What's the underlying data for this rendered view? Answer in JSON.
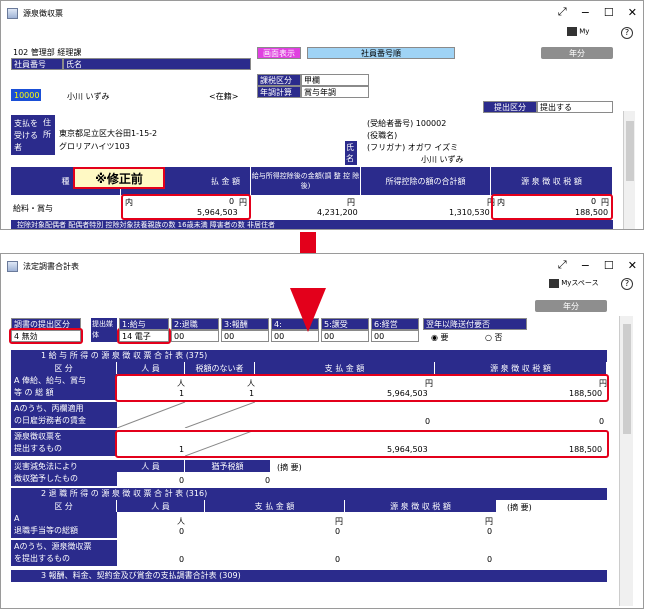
{
  "top": {
    "title": "源泉徴収票",
    "dept": "102 管理部 経理課",
    "col_no": "社員番号",
    "col_name": "氏名",
    "emp_id": "100002",
    "emp_name": "小川 いずみ",
    "status": "<在籍>",
    "screen_btn": "画面表示",
    "sort": "社員番号順",
    "year_btn": "年分",
    "cls_label": "課税区分",
    "cls_val": "甲欄",
    "adj_label": "年調計算",
    "adj_val": "賞与年調",
    "submit_label": "提出区分",
    "submit_val": "提出する",
    "payee_label": "支払を受ける者",
    "addr_label": "住所",
    "addr1": "東京都足立区大谷田1-15-2",
    "addr2": "グロリアハイツ103",
    "recip_no": "(受給者番号) 100002",
    "role": "(役職名)",
    "kana_label": "(フリガナ) オガワ イズミ",
    "name_label": "氏名",
    "name_val": "小川 いずみ",
    "badge": "※修正前",
    "h_kind": "種",
    "h_pay": "払 金 額",
    "h_after": "給与所得控除後の金額(調 整 控 除 後)",
    "h_ded": "所得控除の額の合計額",
    "h_tax": "源 泉 徴 収 税 額",
    "kind": "給料・賞与",
    "inner": "内",
    "yen": "円",
    "zero": "0",
    "pay": "5,964,503",
    "after": "4,231,200",
    "ded": "1,310,530",
    "tax_inner": "内",
    "tax": "188,500",
    "bottom_strip": "控除対象配偶者 配偶者特別 控除対象扶養親族の数 16歳未満 障害者の数 非居住者"
  },
  "bottom": {
    "title": "法定調書合計表",
    "myspace": "Myスペース",
    "year_btn": "年分",
    "sub_label": "調書の提出区分",
    "sub_val": "4 無効",
    "out_label": "提出媒体",
    "out_val": "14 電子",
    "tabs": [
      "1:給与",
      "2:退職",
      "3:報酬",
      "4:",
      "5:譲受",
      "6:経営"
    ],
    "tab_vals": [
      "00",
      "00",
      "00",
      "00",
      "00",
      "00"
    ],
    "next_label": "翌年以降送付要否",
    "opt1": "要",
    "opt2": "否",
    "sec1": "1 給 与 所 得 の 源 泉 徴 収 票 合 計 表 (375)",
    "s1_cols": [
      "区 分",
      "人 員",
      "税額のない者",
      "支 払 金 額",
      "源 泉 徴 収 税 額"
    ],
    "r1_label1": "A 俸給、給与、賞与",
    "r1_label2": "等 の 総 額",
    "r1": {
      "p": "1",
      "n": "1",
      "amt": "5,964,503",
      "tax": "188,500"
    },
    "r2_label1": "Aのうち、丙欄適用",
    "r2_label2": "の日雇労務者の賃金",
    "r2": {
      "amt": "0",
      "tax": "0"
    },
    "r3_label1": "源泉徴収票を",
    "r3_label2": "提出するもの",
    "r3": {
      "p": "1",
      "amt": "5,964,503",
      "tax": "188,500"
    },
    "r4_label1": "災害減免法により",
    "r4_label2": "徴収猶予したもの",
    "r4_h": [
      "人 員",
      "猶予税額",
      "(摘 要)"
    ],
    "r4": {
      "p": "0",
      "tax": "0"
    },
    "sec2": "2 退 職 所 得 の 源 泉 徴 収 票 合 計 表 (316)",
    "s2_cols": [
      "区 分",
      "人 員",
      "支 払 金 額",
      "源 泉 徴 収 税 額",
      "(摘 要)"
    ],
    "s2r1_label1": "A",
    "s2r1_label2": "退職手当等の総額",
    "s2r2_label1": "Aのうち、源泉徴収票",
    "s2r2_label2": "を提出するもの",
    "s2": {
      "p1": "0",
      "a1": "0",
      "t1": "0",
      "p2": "0",
      "a2": "0",
      "t2": "0"
    },
    "sec3": "3 報酬、料金、契約金及び賞金の支払調書合計表 (309)",
    "unit_p": "人",
    "unit_y": "円"
  },
  "colors": {
    "navy": "#2b2b8c",
    "red": "#e3001b",
    "arrow": "#e3001b"
  }
}
